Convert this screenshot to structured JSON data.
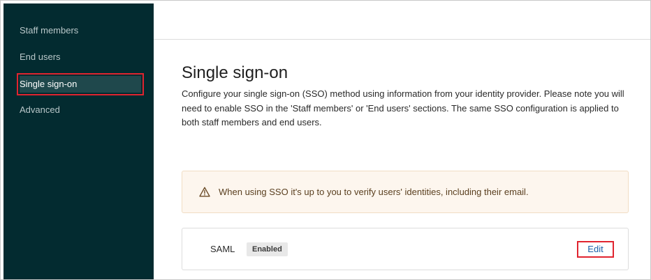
{
  "sidebar": {
    "items": [
      {
        "label": "Staff members"
      },
      {
        "label": "End users"
      },
      {
        "label": "Single sign-on"
      },
      {
        "label": "Advanced"
      }
    ]
  },
  "main": {
    "title": "Single sign-on",
    "description": "Configure your single sign-on (SSO) method using information from your identity provider. Please note you will need to enable SSO in the 'Staff members' or 'End users' sections. The same SSO configuration is applied to both staff members and end users.",
    "warning": {
      "icon": "warning-triangle-icon",
      "text": "When using SSO it's up to you to verify users' identities, including their email."
    },
    "saml": {
      "label": "SAML",
      "status": "Enabled",
      "edit_label": "Edit"
    }
  },
  "colors": {
    "sidebar_bg": "#032b30",
    "highlight_border": "#e0242f",
    "link": "#1a5fa8",
    "warning_bg": "#fdf6ee"
  }
}
